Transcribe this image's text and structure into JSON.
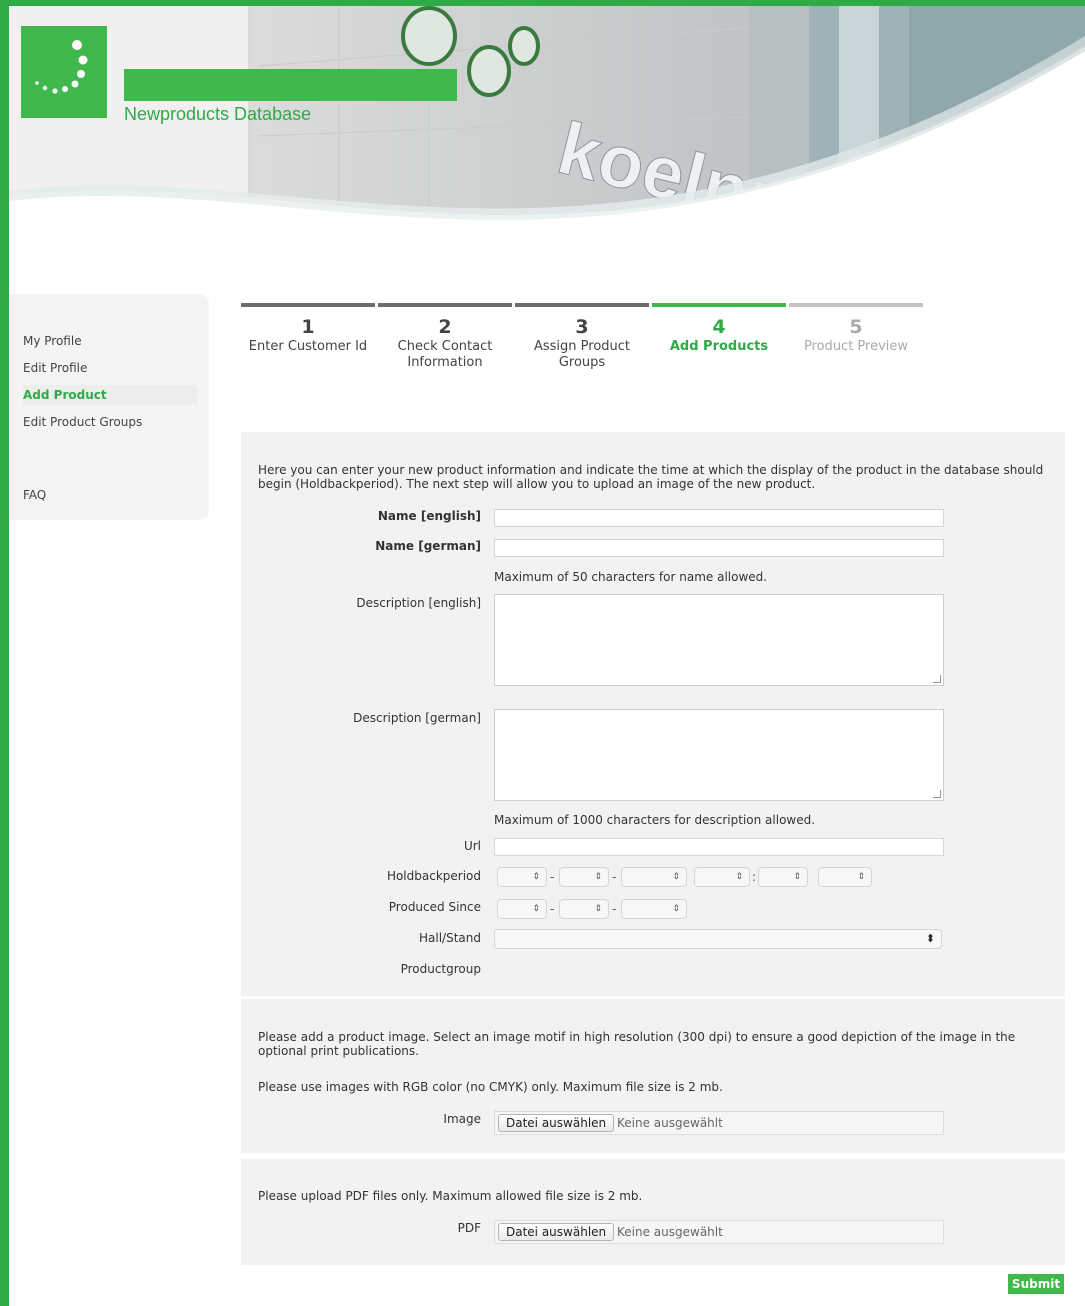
{
  "colors": {
    "brand": "#3fb94b",
    "frame": "#2eaa47",
    "panel": "#f2f2f2"
  },
  "header": {
    "app_title": "Newproducts Database",
    "brand_wordmark": "koelnmesse"
  },
  "sidebar": {
    "items": [
      {
        "label": "My Profile"
      },
      {
        "label": "Edit Profile"
      },
      {
        "label": "Add Product",
        "active": true
      },
      {
        "label": "Edit Product Groups"
      },
      {
        "label": "FAQ"
      }
    ]
  },
  "steps": [
    {
      "num": "1",
      "label": "Enter Customer Id",
      "state": "done"
    },
    {
      "num": "2",
      "label": "Check Contact Information",
      "state": "done"
    },
    {
      "num": "3",
      "label": "Assign Product Groups",
      "state": "done"
    },
    {
      "num": "4",
      "label": "Add Products",
      "state": "active"
    },
    {
      "num": "5",
      "label": "Product Preview",
      "state": "future"
    }
  ],
  "form": {
    "intro": "Here you can enter your new product information and indicate the time at which the display of the product in the database should begin (Holdbackperiod). The next step will allow you to upload an image of the new product.",
    "name_en_label": "Name [english]",
    "name_de_label": "Name [german]",
    "name_hint": "Maximum of 50 characters for name allowed.",
    "desc_en_label": "Description [english]",
    "desc_de_label": "Description [german]",
    "desc_hint": "Maximum of 1000 characters for description allowed.",
    "url_label": "Url",
    "holdback_label": "Holdbackperiod",
    "produced_since_label": "Produced Since",
    "hall_stand_label": "Hall/Stand",
    "productgroup_label": "Productgroup",
    "sep_dash": "-",
    "sep_colon": ":"
  },
  "image_section": {
    "text1": "Please add a product image. Select an image motif in high resolution (300 dpi) to ensure a good depiction of the image in the optional print publications.",
    "text2": "Please use images with RGB color (no CMYK) only. Maximum file size is 2 mb.",
    "label": "Image",
    "button": "Datei auswählen",
    "none": "Keine ausgewählt"
  },
  "pdf_section": {
    "text": "Please upload PDF files only. Maximum allowed file size is 2 mb.",
    "label": "PDF",
    "button": "Datei auswählen",
    "none": "Keine ausgewählt"
  },
  "submit_label": "Submit",
  "icons": {
    "select_arrows": "⇕",
    "hall_arrows": "⬍"
  }
}
